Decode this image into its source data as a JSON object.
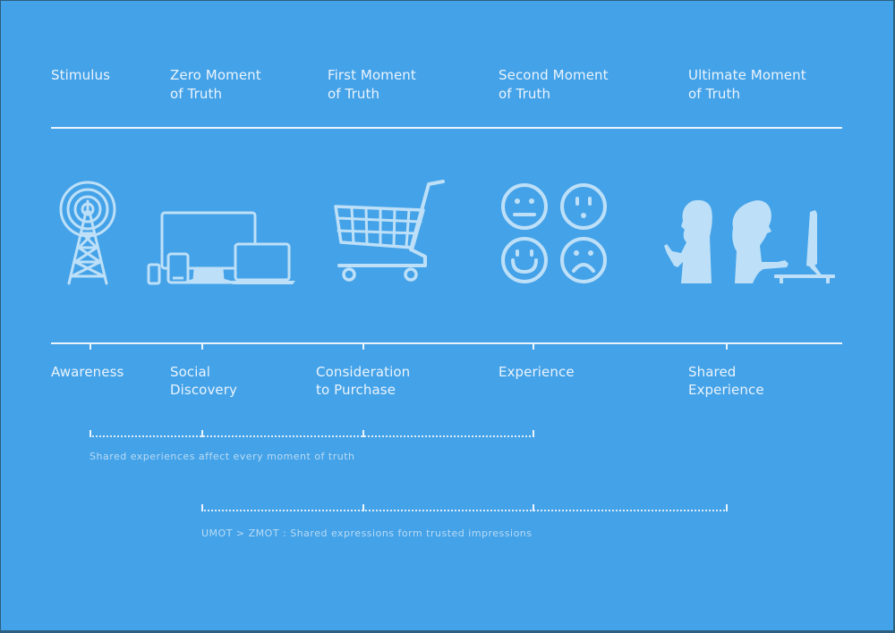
{
  "stages": [
    {
      "id": "stimulus",
      "title": "Stimulus"
    },
    {
      "id": "zmot",
      "title": "Zero Moment\nof Truth"
    },
    {
      "id": "fmot",
      "title": "First Moment\nof Truth"
    },
    {
      "id": "smot",
      "title": "Second Moment\nof Truth"
    },
    {
      "id": "umot",
      "title": "Ultimate Moment\nof Truth"
    }
  ],
  "icons": [
    {
      "name": "radio-tower-icon",
      "depicts": "broadcast tower"
    },
    {
      "name": "devices-icon",
      "depicts": "monitor, laptop, tablet, phone"
    },
    {
      "name": "shopping-cart-icon",
      "depicts": "shopping cart"
    },
    {
      "name": "emotion-faces-icon",
      "depicts": "neutral, surprised, happy, sad faces"
    },
    {
      "name": "shared-people-icon",
      "depicts": "person with phone and person at computer"
    }
  ],
  "phases": [
    {
      "id": "awareness",
      "label": "Awareness"
    },
    {
      "id": "social",
      "label": "Social\nDiscovery"
    },
    {
      "id": "consideration",
      "label": "Consideration\nto Purchase"
    },
    {
      "id": "experience",
      "label": "Experience"
    },
    {
      "id": "shared",
      "label": "Shared\nExperience"
    }
  ],
  "notes": [
    {
      "text": "Shared experiences affect every moment of truth"
    },
    {
      "text": "UMOT > ZMOT : Shared expressions form trusted impressions"
    }
  ],
  "colors": {
    "background": "#44a2e8",
    "foreground": "#eaf4fd",
    "icon": "#bde0f8",
    "note": "#b9dcf6"
  }
}
